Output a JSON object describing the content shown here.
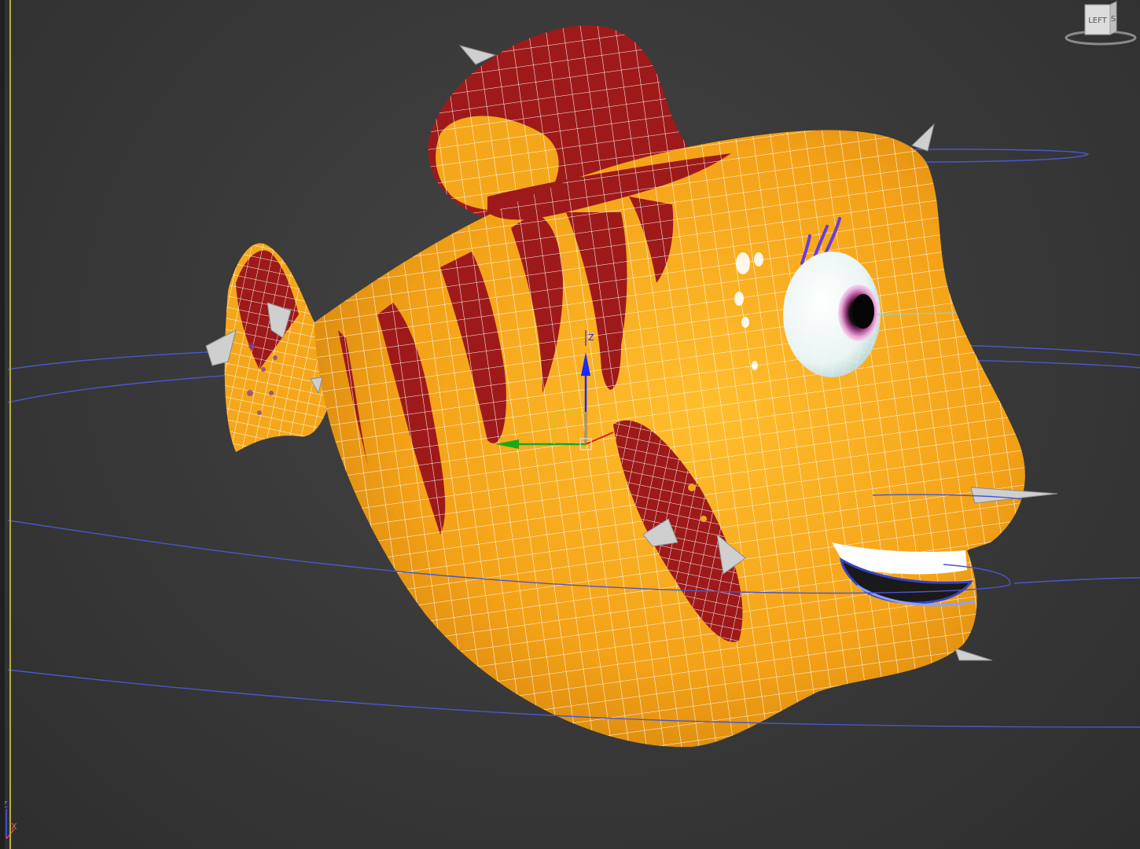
{
  "viewport": {
    "background_color": "#3a3a3a",
    "active_border_color": "#b8ad3e"
  },
  "viewcube": {
    "face_label": "LEFT",
    "side_label": "S"
  },
  "axis_indicator": {
    "z_label": "Z",
    "x_label": "X"
  },
  "model": {
    "body_color": "#f5a71b",
    "stripe_color": "#9e1a1a",
    "wire_color": "#ffffff",
    "spline_color": "#4a57c9",
    "spike_color": "#cfcfcf"
  },
  "icons": [
    "viewcube-icon",
    "move-gizmo-icon",
    "axis-tripod-icon"
  ]
}
